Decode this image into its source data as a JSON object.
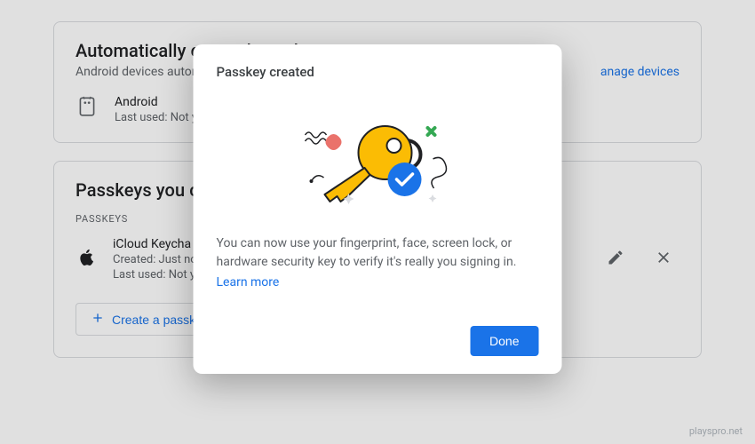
{
  "auto_section": {
    "title": "Automatically created passkeys",
    "subtitle_prefix": "Android devices automatic",
    "link_fragment": "anage devices",
    "device": {
      "name": "Android",
      "last_used": "Last used: Not ye"
    }
  },
  "created_section": {
    "title": "Passkeys you cre",
    "label": "PASSKEYS",
    "passkey": {
      "name": "iCloud Keycha",
      "created": "Created: Just no",
      "last_used": "Last used: Not ye"
    },
    "create_button": "Create a passkey"
  },
  "modal": {
    "title": "Passkey created",
    "body": "You can now use your fingerprint, face, screen lock, or hardware security key to verify it's really you signing in.",
    "learn_more": "Learn more",
    "done": "Done"
  },
  "watermark": "playspro.net",
  "icons": {
    "android": "android-icon",
    "apple": "apple-icon",
    "edit": "pencil-icon",
    "close": "close-icon",
    "plus": "plus-icon",
    "key": "key-illustration",
    "check": "checkmark-icon"
  }
}
